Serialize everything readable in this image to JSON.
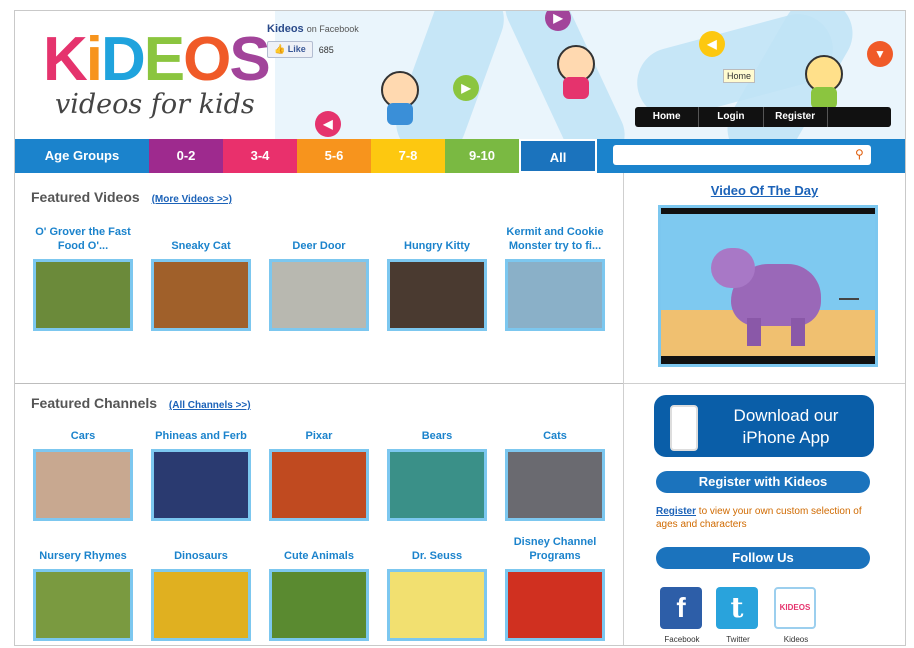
{
  "header": {
    "logo": [
      "K",
      "i",
      "D",
      "E",
      "O",
      "S"
    ],
    "logo_colors": [
      "#e5336d",
      "#f7941d",
      "#1fa3dd",
      "#8bc53f",
      "#f05a28",
      "#a2449a"
    ],
    "tagline": "videos for kids",
    "facebook": {
      "name": "Kideos",
      "suffix": "on Facebook",
      "like": "Like",
      "count": "685"
    },
    "tooltip": "Home",
    "nav": [
      "Home",
      "Login",
      "Register"
    ]
  },
  "age_bar": {
    "label": "Age Groups",
    "groups": [
      {
        "label": "0-2",
        "color": "#9e2a8e"
      },
      {
        "label": "3-4",
        "color": "#e9306c"
      },
      {
        "label": "5-6",
        "color": "#f7941d"
      },
      {
        "label": "7-8",
        "color": "#fdc810"
      },
      {
        "label": "9-10",
        "color": "#7ab942"
      },
      {
        "label": "All",
        "color": "#1b73bd"
      }
    ],
    "search_placeholder": ""
  },
  "featured_videos": {
    "heading": "Featured Videos",
    "more": "(More Videos >>)",
    "items": [
      {
        "title": "O' Grover the Fast Food O'...",
        "thumb": "#6b8a3a"
      },
      {
        "title": "Sneaky Cat",
        "thumb": "#a0602a"
      },
      {
        "title": "Deer Door",
        "thumb": "#b8b8b0"
      },
      {
        "title": "Hungry Kitty",
        "thumb": "#4a3a30"
      },
      {
        "title": "Kermit and Cookie Monster try to fi...",
        "thumb": "#8ab0c8"
      }
    ]
  },
  "featured_channels": {
    "heading": "Featured Channels",
    "more": "(All Channels >>)",
    "items": [
      {
        "title": "Cars",
        "thumb": "#c8a890"
      },
      {
        "title": "Phineas and Ferb",
        "thumb": "#2a3a70"
      },
      {
        "title": "Pixar",
        "thumb": "#c04a20"
      },
      {
        "title": "Bears",
        "thumb": "#3a9088"
      },
      {
        "title": "Cats",
        "thumb": "#6a6a70"
      },
      {
        "title": "Nursery Rhymes",
        "thumb": "#7a9a40"
      },
      {
        "title": "Dinosaurs",
        "thumb": "#e0b020"
      },
      {
        "title": "Cute Animals",
        "thumb": "#5a8a30"
      },
      {
        "title": "Dr. Seuss",
        "thumb": "#f2e070"
      },
      {
        "title": "Disney Channel Programs",
        "thumb": "#d03020"
      }
    ]
  },
  "sidebar": {
    "video_of_day": "Video Of The Day",
    "app_button": "Download our iPhone App",
    "register_heading": "Register with Kideos",
    "register_link": "Register",
    "register_text": " to view your own custom selection of ages and characters",
    "follow_heading": "Follow Us",
    "social": [
      {
        "label": "Facebook",
        "glyph": "f",
        "color": "#2d5ea8"
      },
      {
        "label": "Twitter",
        "glyph": "t",
        "color": "#29a3dc"
      },
      {
        "label": "Kideos BLOG",
        "glyph": "KIDEOS",
        "color": "#ffffff"
      }
    ]
  }
}
